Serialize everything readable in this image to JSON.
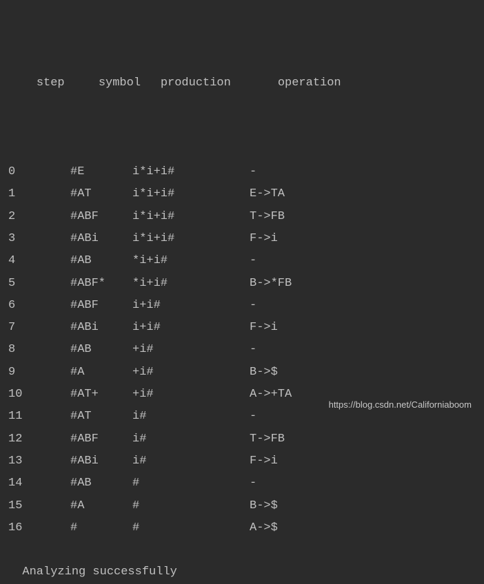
{
  "headers": {
    "step": "step",
    "symbol": "symbol",
    "production": "production",
    "operation": "operation"
  },
  "rows": [
    {
      "step": "0",
      "symbol": "#E",
      "production": "i*i+i#",
      "operation": "-"
    },
    {
      "step": "1",
      "symbol": "#AT",
      "production": "i*i+i#",
      "operation": "E->TA"
    },
    {
      "step": "2",
      "symbol": "#ABF",
      "production": "i*i+i#",
      "operation": "T->FB"
    },
    {
      "step": "3",
      "symbol": "#ABi",
      "production": "i*i+i#",
      "operation": "F->i"
    },
    {
      "step": "4",
      "symbol": "#AB",
      "production": "*i+i#",
      "operation": "-"
    },
    {
      "step": "5",
      "symbol": "#ABF*",
      "production": "*i+i#",
      "operation": "B->*FB"
    },
    {
      "step": "6",
      "symbol": "#ABF",
      "production": "i+i#",
      "operation": "-"
    },
    {
      "step": "7",
      "symbol": "#ABi",
      "production": "i+i#",
      "operation": "F->i"
    },
    {
      "step": "8",
      "symbol": "#AB",
      "production": "+i#",
      "operation": "-"
    },
    {
      "step": "9",
      "symbol": "#A",
      "production": "+i#",
      "operation": "B->$"
    },
    {
      "step": "10",
      "symbol": "#AT+",
      "production": "+i#",
      "operation": "A->+TA"
    },
    {
      "step": "11",
      "symbol": "#AT",
      "production": "i#",
      "operation": "-"
    },
    {
      "step": "12",
      "symbol": "#ABF",
      "production": "i#",
      "operation": "T->FB"
    },
    {
      "step": "13",
      "symbol": "#ABi",
      "production": "i#",
      "operation": "F->i"
    },
    {
      "step": "14",
      "symbol": "#AB",
      "production": "#",
      "operation": "-"
    },
    {
      "step": "15",
      "symbol": "#A",
      "production": "#",
      "operation": "B->$"
    },
    {
      "step": "16",
      "symbol": "#",
      "production": "#",
      "operation": "A->$"
    }
  ],
  "footer": "Analyzing successfully",
  "watermark": "https://blog.csdn.net/Californiaboom"
}
